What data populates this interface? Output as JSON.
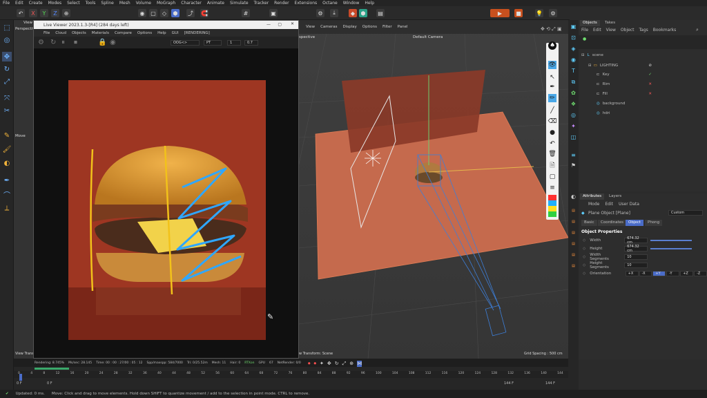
{
  "menubar": {
    "items": [
      "File",
      "Edit",
      "Create",
      "Modes",
      "Select",
      "Tools",
      "Spline",
      "Mesh",
      "Volume",
      "MoGraph",
      "Character",
      "Animate",
      "Simulate",
      "Tracker",
      "Render",
      "Extensions",
      "Octane",
      "Window",
      "Help"
    ]
  },
  "left_viewport": {
    "label": "Perspective",
    "view_label": "View",
    "move_label": "Move",
    "view_transform_label": "View Transf"
  },
  "live_viewer": {
    "title": "Live Viewer 2023.1.3-[R4] (284 days left)",
    "menu": [
      "File",
      "Cloud",
      "Objects",
      "Materials",
      "Compare",
      "Options",
      "Help",
      "GUI",
      "[RENDERING]"
    ],
    "controls": {
      "kernel": "OOG<>",
      "mode": "PT",
      "value1": "1",
      "value2": "0.7"
    },
    "render_status": {
      "rendering": "Rendering: 8.745%",
      "ms": "Ms/sec: 28.145",
      "time": "Time: 00 : 00 : 27/00 : 05 : 12",
      "spp": "Spp/maxspp: 584/7000",
      "tri": "Tri: 0/25.52m",
      "mesh": "Mesh: 11",
      "hair": "Hair: 0",
      "rtx": "RTXon",
      "gpu": "GPU",
      "gpu_val": "67",
      "net": "NetRender: 0/0"
    }
  },
  "viewport": {
    "menu": [
      "View",
      "Cameras",
      "Display",
      "Options",
      "Filter",
      "Panel"
    ],
    "camera_label": "Default Camera",
    "perspective": "spective",
    "grid_spacing": "Grid Spacing : 500 cm",
    "view_transform": "w Transform: Scene"
  },
  "object_manager": {
    "tabs": [
      "Objects",
      "Takes"
    ],
    "menu": [
      "File",
      "Edit",
      "View",
      "Object",
      "Tags",
      "Bookmarks"
    ],
    "objects": [
      {
        "name": "scene"
      },
      {
        "name": "LIGHTING"
      },
      {
        "name": "Key"
      },
      {
        "name": "Rim"
      },
      {
        "name": "Fill"
      },
      {
        "name": "background"
      },
      {
        "name": "hdri"
      }
    ]
  },
  "attributes": {
    "tabs": [
      "Attributes",
      "Layers"
    ],
    "menu": [
      "Mode",
      "Edit",
      "User Data"
    ],
    "object_label": "Plane Object [Plane]",
    "custom_label": "Custom",
    "subtabs": [
      "Basic",
      "Coordinates",
      "Object",
      "Phong"
    ],
    "section": "Object Properties",
    "props": [
      {
        "label": "Width",
        "value": "674.32 cm"
      },
      {
        "label": "Height",
        "value": "674.32 cm"
      },
      {
        "label": "Width Segments",
        "value": "10"
      },
      {
        "label": "Height Segments",
        "value": "10"
      }
    ],
    "orientation_label": "Orientation",
    "orientation_opts": [
      "+X",
      "-X",
      "+Y",
      "-Y",
      "+Z",
      "-Z"
    ],
    "orientation_selected": "+Y"
  },
  "timeline": {
    "ticks": [
      "0",
      "4",
      "8",
      "12",
      "16",
      "20",
      "24",
      "28",
      "32",
      "36",
      "40",
      "44",
      "48",
      "52",
      "56",
      "60",
      "64",
      "68",
      "72",
      "76",
      "80",
      "84",
      "88",
      "92",
      "96",
      "100",
      "104",
      "108",
      "112",
      "116",
      "120",
      "124",
      "128",
      "132",
      "136",
      "140",
      "144"
    ],
    "start_frame": "0 F",
    "current_frame": "0 F",
    "end_frame": "144 F",
    "end_frame2": "144 F"
  },
  "status": {
    "updated": "Updated: 0 ms.",
    "hint": "Move: Click and drag to move elements. Hold down SHIFT to quantize movement / add to the selection in point mode. CTRL to remove."
  },
  "colors": {
    "accent_blue": "#3d7fd9",
    "plane_orange": "#c56a4d",
    "bg_red": "#9b3422",
    "stroke_yellow": "#f2c21a",
    "stroke_blue": "#2fa7ff"
  }
}
